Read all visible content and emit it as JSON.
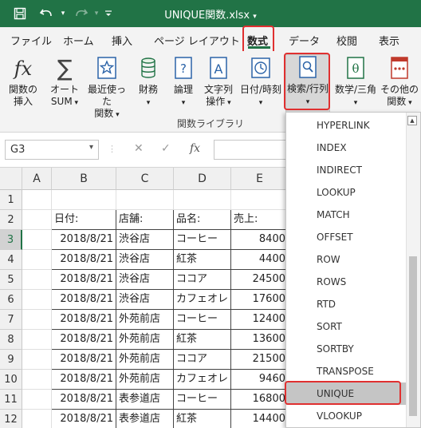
{
  "window": {
    "title": "UNIQUE関数.xlsx"
  },
  "quick_access": {
    "save_icon": "save-icon",
    "undo_icon": "undo-icon",
    "redo_icon": "redo-icon",
    "customize_icon": "customize-qat-icon"
  },
  "tabs": [
    "ファイル",
    "ホーム",
    "挿入",
    "ページ レイアウト",
    "数式",
    "データ",
    "校閲",
    "表示"
  ],
  "active_tab": "数式",
  "ribbon": {
    "insert_function": {
      "line1": "関数の",
      "line2": "挿入"
    },
    "autosum": {
      "line1": "オート",
      "line2": "SUM"
    },
    "recent": {
      "line1": "最近使った",
      "line2": "関数"
    },
    "financial": {
      "label": "財務"
    },
    "logical": {
      "label": "論理"
    },
    "text": {
      "line1": "文字列",
      "line2": "操作"
    },
    "datetime": {
      "label": "日付/時刻"
    },
    "lookup": {
      "label": "検索/行列"
    },
    "math": {
      "label": "数学/三角"
    },
    "more": {
      "line1": "その他の",
      "line2": "関数"
    },
    "group_label": "関数ライブラリ",
    "accent": "#217346"
  },
  "formula_bar": {
    "name_box": "G3",
    "cancel_glyph": "✕",
    "enter_glyph": "✓",
    "fx_glyph": "fx",
    "value": ""
  },
  "grid": {
    "columns": [
      "A",
      "B",
      "C",
      "D",
      "E"
    ],
    "rows": [
      "1",
      "2",
      "3",
      "4",
      "5",
      "6",
      "7",
      "8",
      "9",
      "10",
      "11",
      "12"
    ],
    "header": [
      "日付:",
      "店舗:",
      "品名:",
      "売上:"
    ],
    "data": [
      [
        "2018/8/21",
        "渋谷店",
        "コーヒー",
        "8400"
      ],
      [
        "2018/8/21",
        "渋谷店",
        "紅茶",
        "4400"
      ],
      [
        "2018/8/21",
        "渋谷店",
        "ココア",
        "24500"
      ],
      [
        "2018/8/21",
        "渋谷店",
        "カフェオレ",
        "17600"
      ],
      [
        "2018/8/21",
        "外苑前店",
        "コーヒー",
        "12400"
      ],
      [
        "2018/8/21",
        "外苑前店",
        "紅茶",
        "13600"
      ],
      [
        "2018/8/21",
        "外苑前店",
        "ココア",
        "21500"
      ],
      [
        "2018/8/21",
        "外苑前店",
        "カフェオレ",
        "9460"
      ],
      [
        "2018/8/21",
        "表参道店",
        "コーヒー",
        "16800"
      ],
      [
        "2018/8/21",
        "表参道店",
        "紅茶",
        "14400"
      ]
    ]
  },
  "lookup_menu": {
    "items": [
      "HYPERLINK",
      "INDEX",
      "INDIRECT",
      "LOOKUP",
      "MATCH",
      "OFFSET",
      "ROW",
      "ROWS",
      "RTD",
      "SORT",
      "SORTBY",
      "TRANSPOSE",
      "UNIQUE",
      "VLOOKUP"
    ],
    "highlighted": "UNIQUE"
  }
}
